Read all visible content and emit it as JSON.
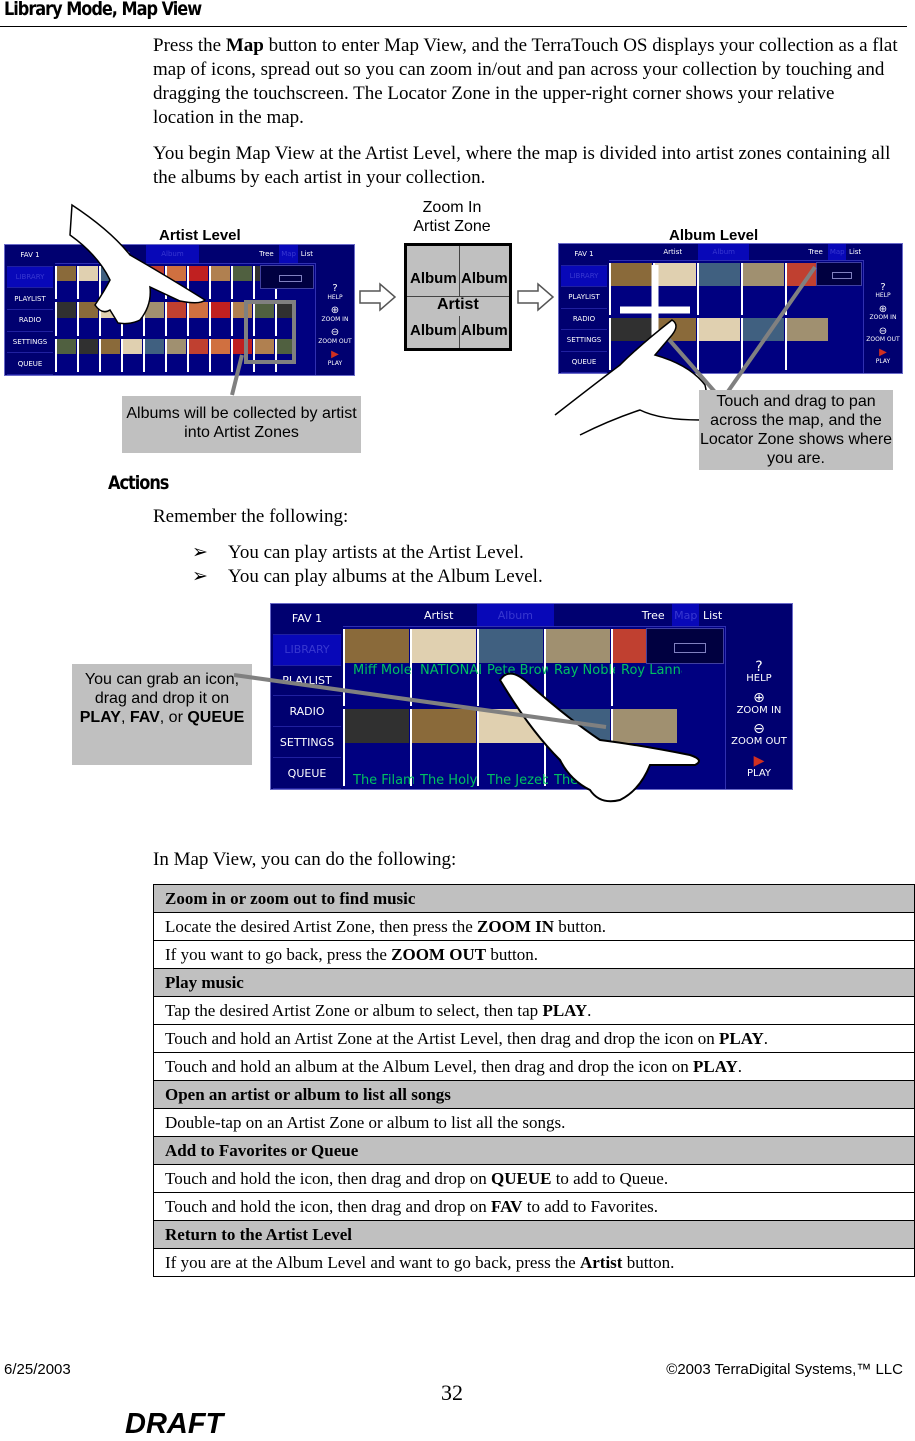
{
  "header": {
    "title": "Library Mode, Map View"
  },
  "intro": [
    "Press the ",
    {
      "b": "Map"
    },
    " button to enter Map View, and the TerraTouch OS displays your collection as a flat map of icons, spread out so you can zoom in/out and pan across your collection by touching and dragging the touchscreen.  The Locator Zone in the upper-right corner shows your relative location in the map."
  ],
  "intro2": "You begin Map View at the Artist Level, where the map is divided into artist zones containing all the albums by each artist in your collection.",
  "figure1": {
    "artist_level_label": "Artist Level",
    "album_level_label": "Album Level",
    "zoom_label_1": "Zoom In",
    "zoom_label_2": "Artist Zone",
    "zoom_box": {
      "album": "Album",
      "artist": "Artist"
    },
    "callout_left": "Albums will be collected by artist into Artist Zones",
    "callout_right": "Touch and drag to pan across the map, and the Locator Zone shows where you are."
  },
  "screen": {
    "nav": [
      "FAV 1",
      "LIBRARY",
      "PLAYLIST",
      "RADIO",
      "SETTINGS",
      "QUEUE"
    ],
    "tabs": [
      "Artist",
      "Album",
      "Tree",
      "Map",
      "List"
    ],
    "controls": [
      "HELP",
      "ZOOM IN",
      "ZOOM OUT",
      "PLAY"
    ],
    "icons": {
      "help": "question-icon",
      "zoom_in": "plus-circle-icon",
      "zoom_out": "minus-circle-icon",
      "play": "play-icon"
    },
    "big_names": [
      "Miff Mole",
      "NATIONAL",
      "Pete Brow",
      "Ray Noble",
      "Roy Lanna Silver"
    ],
    "big_names_bottom": [
      "The Filame",
      "The Holy",
      "The Jezeb",
      "The Origin"
    ],
    "colors": {
      "bg": "#000080",
      "selected": "#0808b8",
      "name_text": "#00c060",
      "play": "#d03020"
    }
  },
  "actions": {
    "heading": "Actions",
    "remember": "Remember the following:",
    "bullets": [
      "You can play artists at the Artist Level.",
      "You can play albums at the Album Level."
    ]
  },
  "figure2": {
    "callout": [
      "You can grab an icon, drag and drop it on ",
      {
        "b": "PLAY"
      },
      ", ",
      {
        "b": "FAV"
      },
      ", or ",
      {
        "b": "QUEUE"
      }
    ]
  },
  "table_intro": "In Map View, you can do the following:",
  "table": [
    {
      "h": true,
      "c": [
        " Zoom in or zoom out to find music"
      ]
    },
    {
      "c": [
        "Locate the desired Artist Zone, then press the ",
        {
          "b": "ZOOM IN"
        },
        " button."
      ]
    },
    {
      "c": [
        "If you want to go back, press the ",
        {
          "b": "ZOOM OUT"
        },
        " button."
      ]
    },
    {
      "h": true,
      "c": [
        "Play music"
      ]
    },
    {
      "c": [
        "Tap the desired Artist Zone or album to select, then tap ",
        {
          "b": "PLAY"
        },
        "."
      ]
    },
    {
      "c": [
        "Touch and hold an Artist Zone at the Artist Level, then drag and drop the icon on ",
        {
          "b": "PLAY"
        },
        "."
      ]
    },
    {
      "c": [
        "Touch and hold an album at the Album Level, then drag and drop the icon on ",
        {
          "b": "PLAY"
        },
        "."
      ]
    },
    {
      "h": true,
      "c": [
        "Open an artist or album to list all songs"
      ]
    },
    {
      "c": [
        "Double-tap on an Artist Zone or album to list all the songs."
      ]
    },
    {
      "h": true,
      "c": [
        " Add to Favorites or Queue"
      ]
    },
    {
      "c": [
        "Touch and hold the icon, then drag and drop on ",
        {
          "b": "QUEUE"
        },
        " to add to Queue."
      ]
    },
    {
      "c": [
        "Touch and hold the icon, then drag and drop on ",
        {
          "b": "FAV"
        },
        " to add to Favorites."
      ]
    },
    {
      "h": true,
      "c": [
        "Return to the Artist Level"
      ]
    },
    {
      "c": [
        "If you are at the Album Level and want to go back, press the ",
        {
          "b": "Artist"
        },
        " button."
      ]
    }
  ],
  "footer": {
    "date": "6/25/2003",
    "copyright": "©2003 TerraDigital Systems,™ LLC",
    "page": "32",
    "draft": "DRAFT"
  }
}
